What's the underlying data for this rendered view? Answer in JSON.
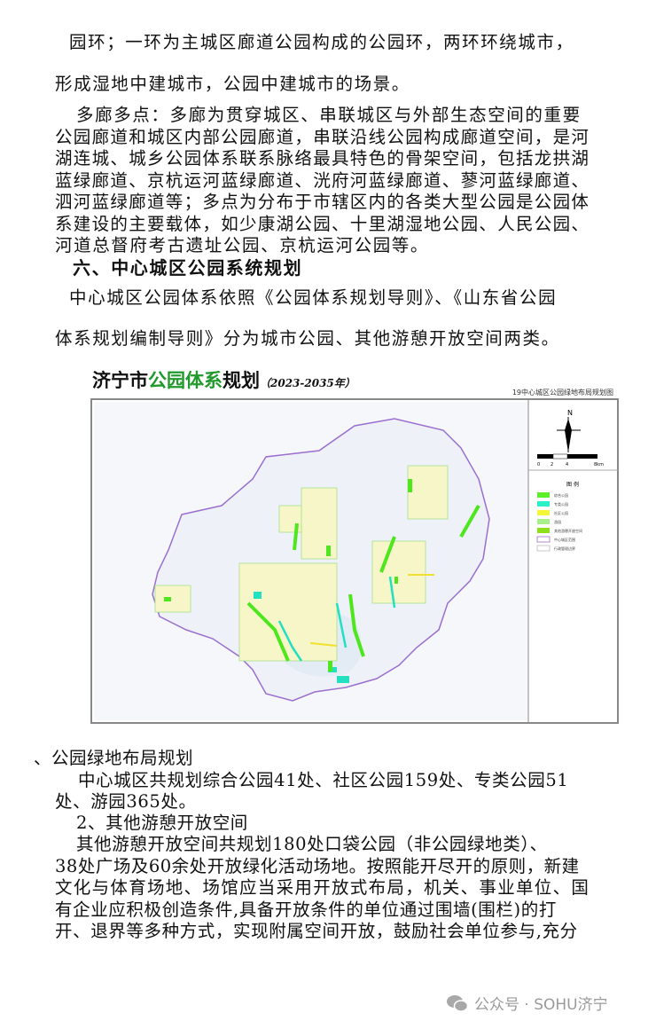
{
  "paragraphs": [
    "园环；一环为主城区廊道公园构成的公园环，两环环绕城市，",
    "形成湿地中建城市，公园中建城市的场景。",
    "多廊多点：多廊为贯穿城区、串联城区与外部生态空间的重要",
    "公园廊道和城区内部公园廊道，串联沿线公园构成廊道空间，是河",
    "湖连城、城乡公园体系联系脉络最具特色的骨架空间，包括龙拱湖",
    "蓝绿廊道、京杭运河蓝绿廊道、洸府河蓝绿廊道、蓼河蓝绿廊道、",
    "泗河蓝绿廊道等；多点为分布于市辖区内的各类大型公园是公园体",
    "系建设的主要载体，如少康湖公园、十里湖湿地公园、人民公园、",
    "河道总督府考古遗址公园、京杭运河公园等。"
  ],
  "heading": "六、中心城区公园系统规划",
  "intro": [
    "中心城区公园体系依照《公园体系规划导则》、《山东省公园",
    "体系规划编制导则》分为城市公园、其他游憩开放空间两类。"
  ],
  "map": {
    "title_black1": "济宁市",
    "title_green": "公园体系",
    "title_black2": "规划",
    "title_years": "（2023-2035年）",
    "subtitle": "19中心城区公园绿地布局规划图",
    "north": "N",
    "scale": [
      "0",
      "2",
      "4",
      "8km"
    ],
    "legend_title": "图 例",
    "legend": [
      {
        "label": "综合公园",
        "color": "#5cf02a"
      },
      {
        "label": "专类公园",
        "color": "#2af0c8"
      },
      {
        "label": "社区公园",
        "color": "#f5f53a"
      },
      {
        "label": "游园",
        "color": "#a8f08c"
      },
      {
        "label": "其他游憩开放空间",
        "color": "#8ee01e"
      },
      {
        "label": "中心城区范围",
        "color": "#9b6fd0"
      },
      {
        "label": "行政管理边界",
        "color": "#bbbbbb"
      }
    ]
  },
  "after": [
    "、公园绿地布局规划",
    "中心城区共规划综合公园41处、社区公园159处、专类公园51",
    "处、游园365处。",
    "2、其他游憩开放空间",
    "其他游憩开放空间共规划180处口袋公园（非公园绿地类）、",
    "38处广场及60余处开放绿化活动场地。按照能开尽开的原则，新建",
    "文化与体育场地、场馆应当采用开放式布局，机关、事业单位、国",
    "有企业应积极创造条件,具备开放条件的单位通过围墙(围栏)的打",
    "开、退界等多种方式，实现附属空间开放，鼓励社会单位参与,充分"
  ],
  "watermark": "公众号 · SOHU济宁"
}
